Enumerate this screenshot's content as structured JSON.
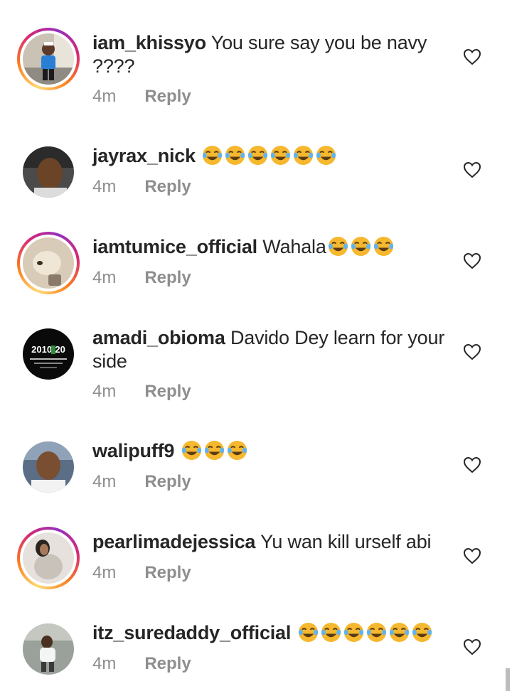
{
  "comments": [
    {
      "username": "iam_khissyo",
      "text": "You sure say you be navy ????",
      "emoji_count": 0,
      "time": "4m",
      "reply": "Reply",
      "story_ring": true
    },
    {
      "username": "jayrax_nick",
      "text": "",
      "emoji_count": 6,
      "time": "4m",
      "reply": "Reply",
      "story_ring": false
    },
    {
      "username": "iamtumice_official",
      "text": "Wahala",
      "emoji_count": 3,
      "time": "4m",
      "reply": "Reply",
      "story_ring": true
    },
    {
      "username": "amadi_obioma",
      "text": "Davido  Dey learn for your side",
      "emoji_count": 0,
      "time": "4m",
      "reply": "Reply",
      "story_ring": false,
      "avatar_text": "2010:20"
    },
    {
      "username": "walipuff9",
      "text": "",
      "emoji_count": 3,
      "time": "4m",
      "reply": "Reply",
      "story_ring": false
    },
    {
      "username": "pearlimadejessica",
      "text": "Yu wan kill urself abi",
      "emoji_count": 0,
      "time": "4m",
      "reply": "Reply",
      "story_ring": true
    },
    {
      "username": "itz_suredaddy_official",
      "text": "",
      "emoji_count": 6,
      "time": "4m",
      "reply": "Reply",
      "story_ring": false
    }
  ],
  "icons": {
    "like": "heart-outline-icon",
    "emoji": "face-with-tears-of-joy-emoji"
  },
  "colors": {
    "text": "#262626",
    "secondary": "#8e8e8e",
    "emoji": "#f5b82e"
  }
}
